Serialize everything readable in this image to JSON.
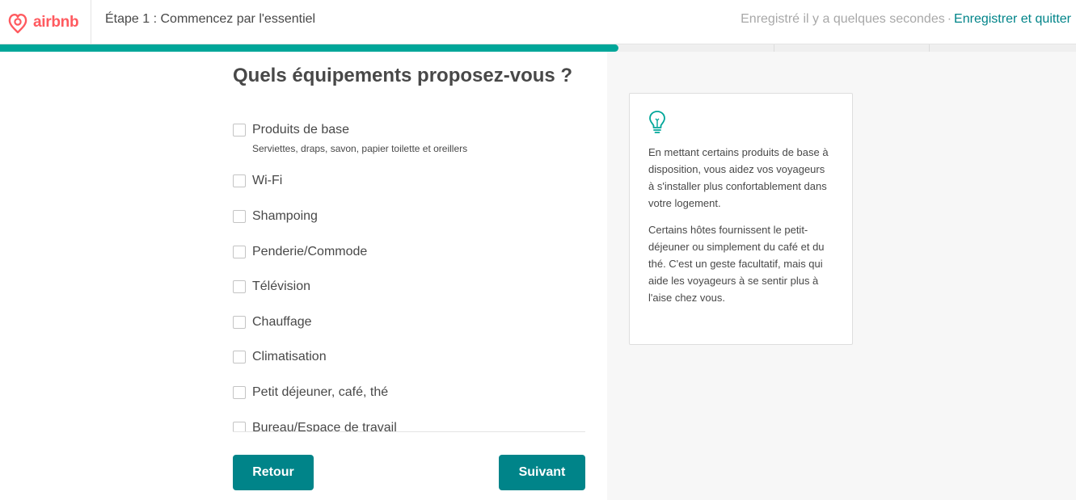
{
  "header": {
    "logo_text": "airbnb",
    "step_title": "Étape 1 : Commencez par l'essentiel",
    "saved_status": "Enregistré il y a quelques secondes",
    "separator": "·",
    "save_quit_label": "Enregistrer et quitter"
  },
  "progress": {
    "fraction": 0.575
  },
  "main": {
    "title": "Quels équipements proposez-vous ?",
    "amenities": [
      {
        "label": "Produits de base",
        "description": "Serviettes, draps, savon, papier toilette et oreillers",
        "checked": false
      },
      {
        "label": "Wi-Fi",
        "checked": false
      },
      {
        "label": "Shampoing",
        "checked": false
      },
      {
        "label": "Penderie/Commode",
        "checked": false
      },
      {
        "label": "Télévision",
        "checked": false
      },
      {
        "label": "Chauffage",
        "checked": false
      },
      {
        "label": "Climatisation",
        "checked": false
      },
      {
        "label": "Petit déjeuner, café, thé",
        "checked": false
      },
      {
        "label": "Bureau/Espace de travail",
        "checked": false
      }
    ]
  },
  "tip": {
    "icon": "lightbulb-icon",
    "paragraphs": [
      "En mettant certains produits de base à disposition, vous aidez vos voyageurs à s'installer plus confortablement dans votre logement.",
      "Certains hôtes fournissent le petit-déjeuner ou simplement du café et du thé. C'est un geste facultatif, mais qui aide les voyageurs à se sentir plus à l'aise chez vous."
    ]
  },
  "buttons": {
    "back_label": "Retour",
    "next_label": "Suivant"
  },
  "colors": {
    "brand": "#ff5a5f",
    "accent": "#008489",
    "progress": "#00a699"
  }
}
